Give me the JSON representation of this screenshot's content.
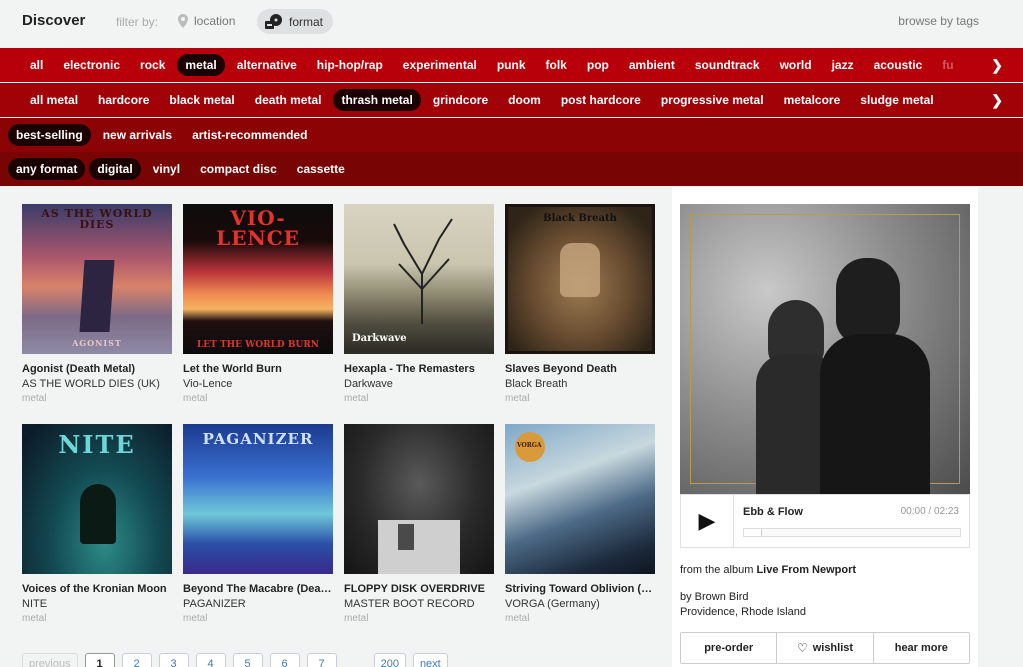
{
  "header": {
    "title": "Discover",
    "filter_by": "filter by:",
    "location": "location",
    "format": "format",
    "browse_tags": "browse by tags"
  },
  "genres": [
    "all",
    "electronic",
    "rock",
    "metal",
    "alternative",
    "hip-hop/rap",
    "experimental",
    "punk",
    "folk",
    "pop",
    "ambient",
    "soundtrack",
    "world",
    "jazz",
    "acoustic",
    "fu"
  ],
  "genres_selected": "metal",
  "subgenres": [
    "all metal",
    "hardcore",
    "black metal",
    "death metal",
    "thrash metal",
    "grindcore",
    "doom",
    "post hardcore",
    "progressive metal",
    "metalcore",
    "sludge metal"
  ],
  "subgenres_selected": "thrash metal",
  "sort": [
    "best-selling",
    "new arrivals",
    "artist-recommended"
  ],
  "sort_selected": "best-selling",
  "formats": [
    "any format",
    "digital",
    "vinyl",
    "compact disc",
    "cassette"
  ],
  "formats_selected": [
    "any format",
    "digital"
  ],
  "albums": [
    {
      "title": "Agonist (Death Metal)",
      "artist": "AS THE WORLD DIES (UK)",
      "genre": "metal",
      "cover_text": "AS THE WORLD DIES",
      "cover_sub": "AGONIST"
    },
    {
      "title": "Let the World Burn",
      "artist": "Vio-Lence",
      "genre": "metal",
      "cover_text": "VIO-LENCE",
      "cover_sub": "LET THE WORLD BURN"
    },
    {
      "title": "Hexapla - The Remasters",
      "artist": "Darkwave",
      "genre": "metal",
      "cover_text": "",
      "cover_sub": "Darkwave"
    },
    {
      "title": "Slaves Beyond Death",
      "artist": "Black Breath",
      "genre": "metal",
      "cover_text": "Black Breath",
      "cover_sub": ""
    },
    {
      "title": "Voices of the Kronian Moon",
      "artist": "NITE",
      "genre": "metal",
      "cover_text": "NITE",
      "cover_sub": ""
    },
    {
      "title": "Beyond The Macabre (Deat...",
      "artist": "PAGANIZER",
      "genre": "metal",
      "cover_text": "PAGANIZER",
      "cover_sub": ""
    },
    {
      "title": "FLOPPY DISK OVERDRIVE",
      "artist": "MASTER BOOT RECORD",
      "genre": "metal",
      "cover_text": "",
      "cover_sub": ""
    },
    {
      "title": "Striving Toward Oblivion (Bl...",
      "artist": "VORGA (Germany)",
      "genre": "metal",
      "cover_text": "VORGA",
      "cover_sub": ""
    }
  ],
  "pager": {
    "previous": "previous",
    "pages": [
      "1",
      "2",
      "3",
      "4",
      "5",
      "6",
      "7"
    ],
    "current": "1",
    "last": "200",
    "next": "next"
  },
  "player": {
    "track": "Ebb & Flow",
    "time": "00:00 / 02:23",
    "progress": 0.0,
    "from_album_prefix": "from the album",
    "album": "Live From Newport",
    "by": "by Brown Bird",
    "location": "Providence, Rhode Island",
    "preorder": "pre-order",
    "wishlist": "wishlist",
    "hear_more": "hear more"
  }
}
